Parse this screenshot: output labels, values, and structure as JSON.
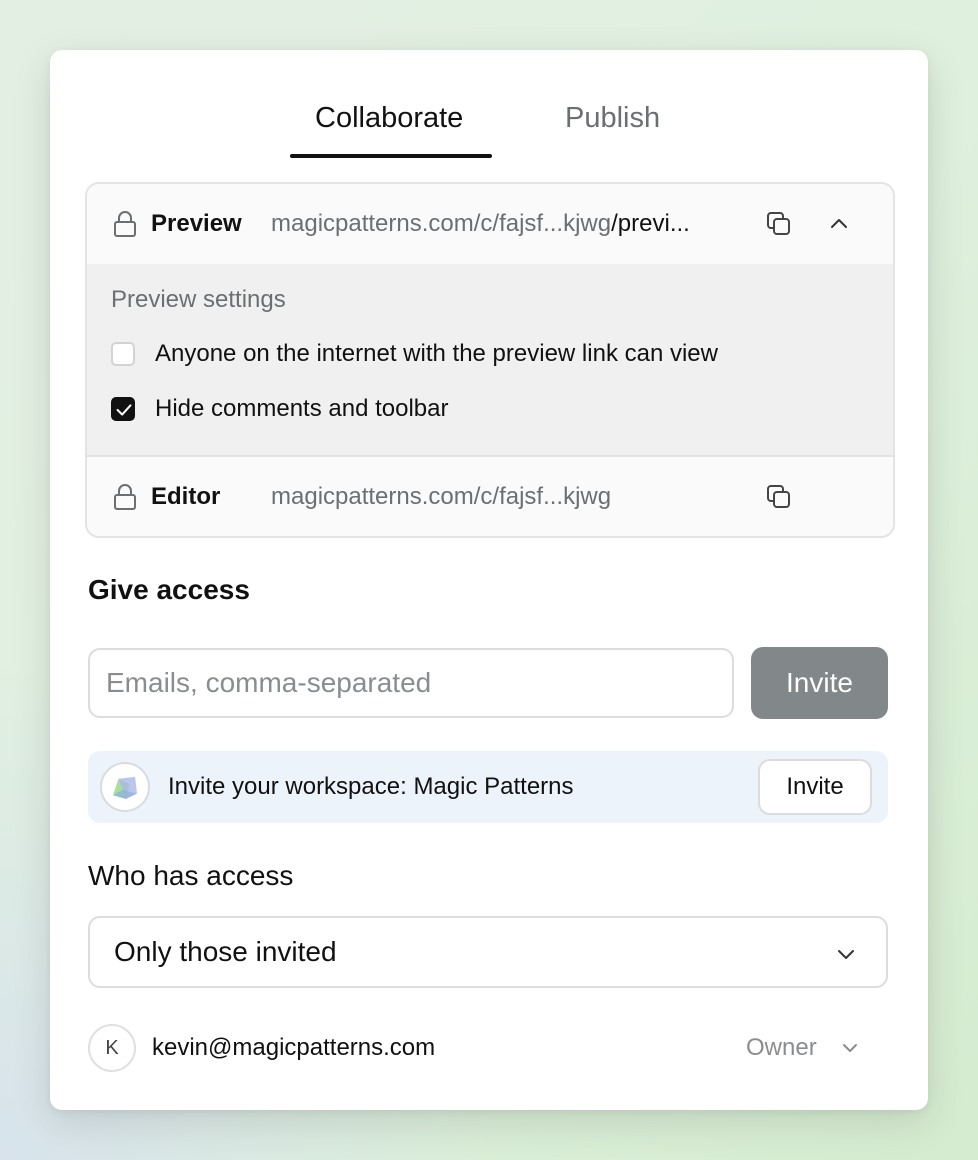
{
  "tabs": [
    {
      "label": "Collaborate",
      "active": true
    },
    {
      "label": "Publish",
      "active": false
    }
  ],
  "links": {
    "preview": {
      "label": "Preview",
      "url_muted": "magicpatterns.com/c/fajsf...kjwg",
      "url_dark": "/previ...",
      "icons": [
        "lock-icon",
        "copy-icon",
        "chevron-up-icon"
      ]
    },
    "settings": {
      "title": "Preview settings",
      "options": [
        {
          "label": "Anyone on the internet with the preview link can view",
          "checked": false
        },
        {
          "label": "Hide comments and toolbar",
          "checked": true
        }
      ]
    },
    "editor": {
      "label": "Editor",
      "url": "magicpatterns.com/c/fajsf...kjwg",
      "icons": [
        "lock-icon",
        "copy-icon"
      ]
    }
  },
  "give_access": {
    "heading": "Give access",
    "placeholder": "Emails, comma-separated",
    "value": "",
    "invite_label": "Invite"
  },
  "workspace": {
    "text": "Invite your workspace: Magic Patterns",
    "invite_label": "Invite"
  },
  "who_has_access": {
    "heading": "Who has access",
    "selected": "Only those invited"
  },
  "members": [
    {
      "initial": "K",
      "email": "kevin@magicpatterns.com",
      "role": "Owner"
    }
  ],
  "colors": {
    "accent": "#111111",
    "muted_text": "#6b6f72",
    "invite_button": "#828789",
    "workspace_bg": "#ecf3fb"
  }
}
